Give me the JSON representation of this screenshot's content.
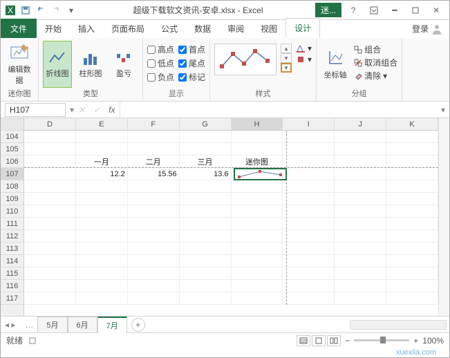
{
  "title": "超级下载软文资讯-安卓.xlsx - Excel",
  "mini_badge": "迷...",
  "tabs": {
    "file": "文件",
    "start": "开始",
    "insert": "插入",
    "layout": "页面布局",
    "formula": "公式",
    "data": "数据",
    "review": "审阅",
    "view": "视图",
    "design": "设计",
    "login": "登录"
  },
  "ribbon": {
    "g1": {
      "label": "迷你图",
      "btn1": "编辑数据"
    },
    "g2": {
      "label": "类型",
      "b1": "折线图",
      "b2": "柱形图",
      "b3": "盈亏"
    },
    "g3": {
      "label": "显示",
      "c1": "高点",
      "c2": "低点",
      "c3": "负点",
      "c4": "首点",
      "c5": "尾点",
      "c6": "标记"
    },
    "g4": {
      "label": "样式"
    },
    "g5": {
      "label": "分组",
      "axis": "坐标轴",
      "grp": "组合",
      "ungrp": "取消组合",
      "clear": "清除"
    }
  },
  "namebox": "H107",
  "cols": [
    "D",
    "E",
    "F",
    "G",
    "H",
    "I",
    "J",
    "K"
  ],
  "rows": [
    "104",
    "105",
    "106",
    "107",
    "108",
    "109",
    "110",
    "111",
    "112",
    "113",
    "114",
    "115",
    "116",
    "117"
  ],
  "data": {
    "r106": {
      "E": "一月",
      "F": "二月",
      "G": "三月",
      "H": "迷你图"
    },
    "r107": {
      "E": "12.2",
      "F": "15.56",
      "G": "13.6"
    }
  },
  "sheets": {
    "s1": "5月",
    "s2": "6月",
    "s3": "7月"
  },
  "status": {
    "ready": "就绪",
    "zoom": "100%"
  },
  "chart_data": {
    "type": "line",
    "location": "sparkline in cell H107",
    "categories": [
      "一月",
      "二月",
      "三月"
    ],
    "values": [
      12.2,
      15.56,
      13.6
    ],
    "markers": true,
    "marker_color": "#c0504d",
    "line_color": "#5a7a9e"
  },
  "watermark": "xuexila.com"
}
